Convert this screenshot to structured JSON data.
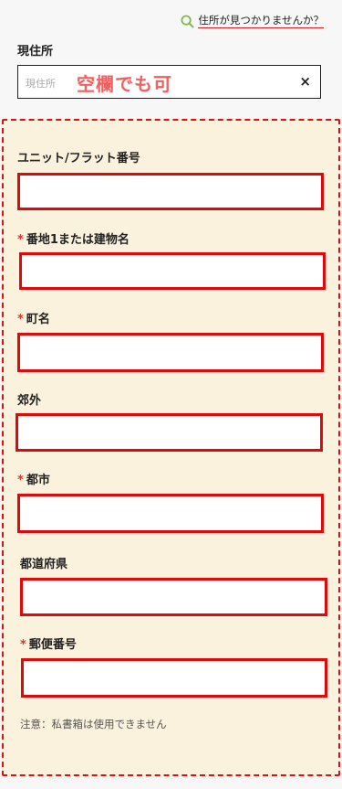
{
  "header": {
    "not_found_link": "住所が見つかりませんか？"
  },
  "current_address": {
    "label": "現住所",
    "placeholder": "現住所",
    "annotation": "空欄でも可",
    "clear_symbol": "×"
  },
  "form": {
    "unit": {
      "label": "ユニット/フラット番号",
      "required": false
    },
    "street": {
      "label": "番地1または建物名",
      "required": true
    },
    "town": {
      "label": "町名",
      "required": true
    },
    "suburb": {
      "label": "郊外",
      "required": false
    },
    "city": {
      "label": "都市",
      "required": true
    },
    "prefecture": {
      "label": "都道府県",
      "required": false
    },
    "postal": {
      "label": "郵便番号",
      "required": true
    },
    "required_mark": "*",
    "note": "注意：私書箱は使用できません"
  },
  "colors": {
    "accent_red": "#e00808",
    "dashed_bg": "#fbf2de",
    "search_icon": "#7ab648"
  }
}
